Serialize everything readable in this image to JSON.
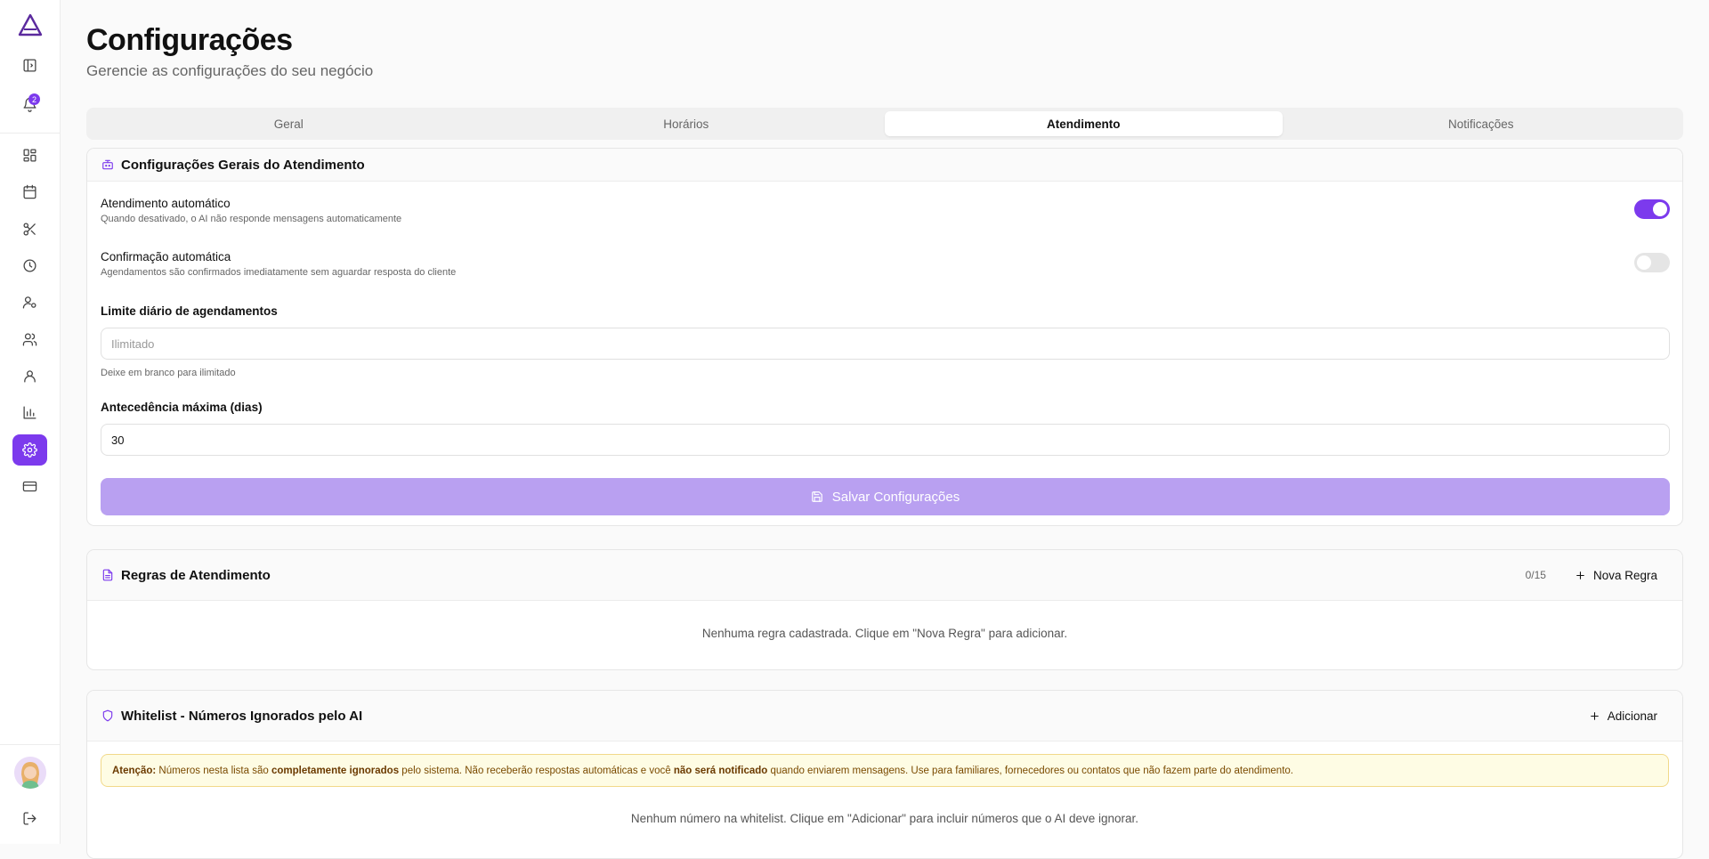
{
  "sidebar": {
    "notifications_count": "2",
    "items": [
      {
        "icon": "panel-toggle-icon"
      },
      {
        "icon": "bell-icon"
      },
      {
        "icon": "dashboard-icon"
      },
      {
        "icon": "calendar-icon"
      },
      {
        "icon": "scissors-icon"
      },
      {
        "icon": "clock-icon"
      },
      {
        "icon": "user-settings-icon"
      },
      {
        "icon": "users-icon"
      },
      {
        "icon": "user-icon"
      },
      {
        "icon": "bar-chart-icon"
      },
      {
        "icon": "gear-icon"
      },
      {
        "icon": "credit-card-icon"
      }
    ],
    "active_color": "#7c3aed"
  },
  "header": {
    "title": "Configurações",
    "subtitle": "Gerencie as configurações do seu negócio"
  },
  "tabs": [
    {
      "label": "Geral"
    },
    {
      "label": "Horários"
    },
    {
      "label": "Atendimento"
    },
    {
      "label": "Notificações"
    }
  ],
  "general": {
    "title": "Configurações Gerais do Atendimento",
    "auto_reply": {
      "label": "Atendimento automático",
      "description": "Quando desativado, o AI não responde mensagens automaticamente",
      "enabled": true
    },
    "auto_confirm": {
      "label": "Confirmação automática",
      "description": "Agendamentos são confirmados imediatamente sem aguardar resposta do cliente",
      "enabled": false
    },
    "daily_limit": {
      "label": "Limite diário de agendamentos",
      "placeholder": "Ilimitado",
      "value": "",
      "hint": "Deixe em branco para ilimitado"
    },
    "max_advance": {
      "label": "Antecedência máxima (dias)",
      "value": "30"
    },
    "save_label": "Salvar Configurações"
  },
  "rules": {
    "title": "Regras de Atendimento",
    "count": "0/15",
    "new_label": "Nova Regra",
    "empty": "Nenhuma regra cadastrada. Clique em \"Nova Regra\" para adicionar."
  },
  "whitelist": {
    "title": "Whitelist - Números Ignorados pelo AI",
    "add_label": "Adicionar",
    "alert": {
      "lead": "Atenção:",
      "t1": " Números nesta lista são ",
      "b1": "completamente ignorados",
      "t2": " pelo sistema. Não receberão respostas automáticas e você ",
      "b2": "não será notificado",
      "t3": " quando enviarem mensagens. Use para familiares, fornecedores ou contatos que não fazem parte do atendimento."
    },
    "empty": "Nenhum número na whitelist. Clique em \"Adicionar\" para incluir números que o AI deve ignorar."
  }
}
